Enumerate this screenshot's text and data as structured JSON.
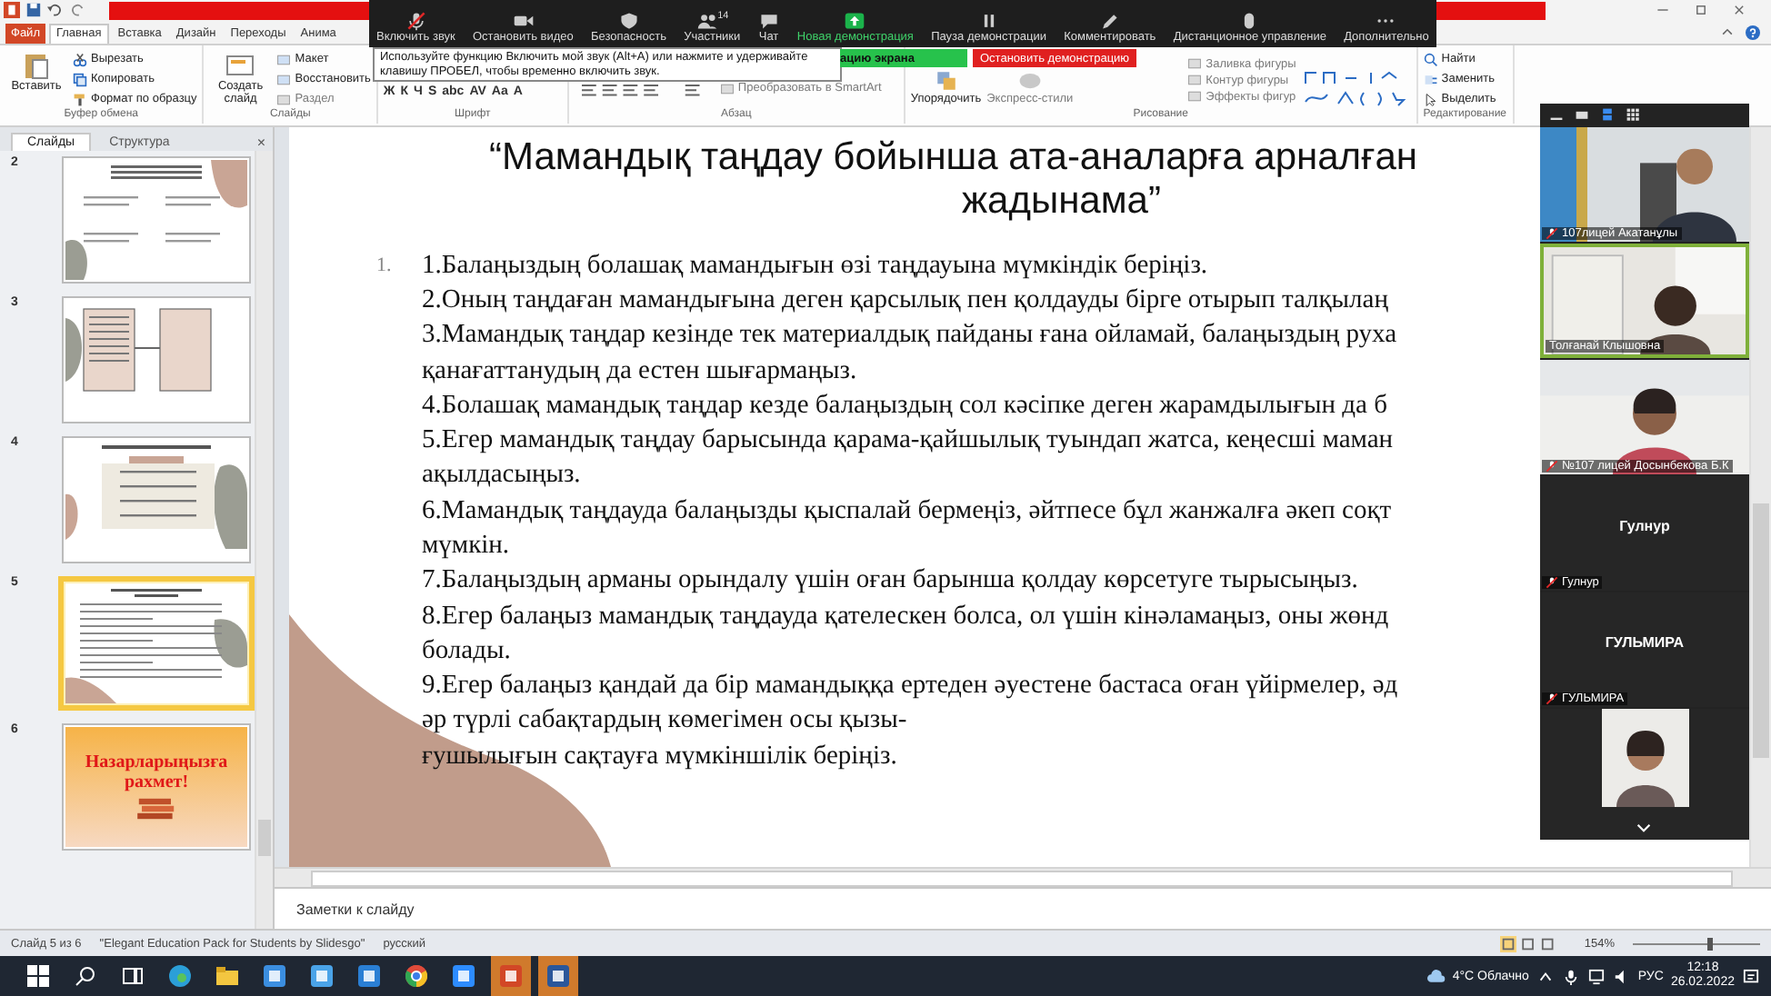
{
  "ribbon": {
    "tabs": [
      {
        "label": "Файл",
        "selected": false,
        "kind": "file"
      },
      {
        "label": "Главная",
        "selected": true,
        "kind": "tab"
      },
      {
        "label": "Вставка",
        "selected": false,
        "kind": "tab"
      },
      {
        "label": "Дизайн",
        "selected": false,
        "kind": "tab"
      },
      {
        "label": "Переходы",
        "selected": false,
        "kind": "tab"
      },
      {
        "label": "Анима",
        "selected": false,
        "kind": "tab"
      }
    ],
    "groups": [
      {
        "label": "Буфер обмена",
        "large": [
          {
            "label": "Вставить",
            "kind": "paste",
            "disabled": false
          }
        ],
        "small": [
          {
            "label": "Вырезать",
            "kind": "cut",
            "disabled": false
          },
          {
            "label": "Копировать",
            "kind": "copy",
            "disabled": false
          },
          {
            "label": "Формат по образцу",
            "kind": "brush",
            "disabled": false
          }
        ]
      },
      {
        "label": "Слайды",
        "large": [
          {
            "label": "Создать слайд",
            "kind": "slide",
            "disabled": false
          }
        ],
        "small": [
          {
            "label": "Макет",
            "kind": "layout",
            "disabled": false
          },
          {
            "label": "Восстановить",
            "kind": "reset",
            "disabled": false
          },
          {
            "label": "Раздел",
            "kind": "section",
            "disabled": true
          }
        ]
      },
      {
        "label": "Шрифт",
        "glyphs": [
          "Ж",
          "К",
          "Ч",
          "S",
          "abc",
          "AV",
          "Aa",
          "A"
        ]
      },
      {
        "label": "Абзац",
        "small": [
          {
            "label": "Преобразовать в SmartArt",
            "kind": "smartart",
            "disabled": true
          }
        ]
      },
      {
        "label": "Рисование",
        "large": [
          {
            "label": "Упорядочить",
            "kind": "arrange",
            "disabled": false
          },
          {
            "label": "Экспресс-стили",
            "kind": "styles",
            "disabled": true
          }
        ],
        "small": [
          {
            "label": "Заливка фигуры",
            "kind": "fill",
            "disabled": true
          },
          {
            "label": "Контур фигуры",
            "kind": "outline",
            "disabled": true
          },
          {
            "label": "Эффекты фигур",
            "kind": "effects",
            "disabled": true
          }
        ]
      },
      {
        "label": "Редактирование",
        "small": [
          {
            "label": "Найти",
            "kind": "find",
            "disabled": false
          },
          {
            "label": "Заменить",
            "kind": "replace",
            "disabled": false
          },
          {
            "label": "Выделить",
            "kind": "select",
            "disabled": false
          }
        ]
      }
    ]
  },
  "meeting": {
    "buttons": [
      {
        "label": "Включить звук",
        "kind": "mic"
      },
      {
        "label": "Остановить видео",
        "kind": "video"
      },
      {
        "label": "Безопасность",
        "kind": "shield"
      },
      {
        "label": "Участники",
        "kind": "people",
        "count": "14"
      },
      {
        "label": "Чат",
        "kind": "chat"
      },
      {
        "label": "Новая демонстрация",
        "kind": "share"
      },
      {
        "label": "Пауза демонстрации",
        "kind": "pause"
      },
      {
        "label": "Комментировать",
        "kind": "pen"
      },
      {
        "label": "Дистанционное управление",
        "kind": "mouse"
      },
      {
        "label": "Дополнительно",
        "kind": "more"
      }
    ],
    "tooltip": "Используйте функцию Включить мой звук (Alt+A) или нажмите и удерживайте клавишу ПРОБЕЛ, чтобы временно включить звук.",
    "sharing_label": "ацию экрана",
    "stop_button": "Остановить демонстрацию",
    "tiles": [
      {
        "kind": "video",
        "name": "107лицей Акатанұлы",
        "muted": true,
        "speaking": false
      },
      {
        "kind": "video",
        "name": "Толғанай Клышовна",
        "muted": false,
        "speaking": true
      },
      {
        "kind": "video",
        "name": "№107 лицей Досынбекова Б.К",
        "muted": true,
        "speaking": false
      },
      {
        "kind": "avatar",
        "display": "Гулнур",
        "name": "Гулнур",
        "muted": true,
        "speaking": false
      },
      {
        "kind": "avatar",
        "display": "ГУЛЬМИРА",
        "name": "ГУЛЬМИРА",
        "muted": true,
        "speaking": false
      },
      {
        "kind": "small_video",
        "speaking": false
      }
    ]
  },
  "slides_panel": {
    "tabs": [
      {
        "label": "Слайды",
        "selected": true
      },
      {
        "label": "Структура",
        "selected": false
      }
    ],
    "close": "×",
    "slides": [
      {
        "number": "2",
        "selected": false,
        "kind": "grid"
      },
      {
        "number": "3",
        "selected": false,
        "kind": "boxes"
      },
      {
        "number": "4",
        "selected": false,
        "kind": "list"
      },
      {
        "number": "5",
        "selected": true,
        "kind": "content"
      },
      {
        "number": "6",
        "selected": false,
        "kind": "thanks",
        "title": "Назарларыңызға рахмет!"
      }
    ]
  },
  "slide": {
    "title": [
      "“Мамандық таңдау бойынша ата-аналарға арналған",
      "жадынама”"
    ],
    "marker": "1.",
    "lines": [
      "1.Балаңыздың болашақ мамандығын өзі таңдауына мүмкіндік беріңіз.",
      "2.Оның таңдаған мамандығына деген қарсылық пен қолдауды бірге отырып талқылаң",
      "3.Мамандық таңдар кезінде тек материалдық пайданы ғана ойламай, балаңыздың руха",
      "қанағаттанудың да естен шығармаңыз.",
      "4.Болашақ мамандық таңдар кезде балаңыздың сол кәсіпке деген жарамдылығын да б",
      "5.Егер мамандық таңдау барысында қарама-қайшылық туындап жатса, кеңесші маман",
      "ақылдасыңыз.",
      "6.Мамандық таңдауда балаңызды қыспалай бермеңіз, әйтпесе бұл жанжалға әкеп соқт",
      "мүмкін.",
      "7.Балаңыздың арманы орындалу үшін оған барынша қолдау көрсетуге тырысыңыз.",
      "8.Егер балаңыз мамандық таңдауда қателескен болса, ол үшін кінәламаңыз, оны жөнд",
      "болады.",
      "9.Егер балаңыз қандай да бір мамандыққа ертеден әуестене бастаса оған үйірмелер, әд",
      "әр түрлі сабақтардың көмегімен осы қызы-",
      "ғушылығын сақтауға мүмкіншілік беріңіз."
    ]
  },
  "notes": {
    "placeholder": "Заметки к слайду"
  },
  "status_bar": {
    "slide": "Слайд 5 из 6",
    "theme": "\"Elegant Education Pack for Students by Slidesgo\"",
    "language": "русский",
    "zoom": "154%",
    "level": 0.6
  },
  "taskbar": {
    "apps": [
      {
        "kind": "start"
      },
      {
        "kind": "search"
      },
      {
        "kind": "taskview"
      },
      {
        "kind": "edge"
      },
      {
        "kind": "folder"
      },
      {
        "kind": "store"
      },
      {
        "kind": "mail"
      },
      {
        "kind": "l_app"
      },
      {
        "kind": "chrome"
      },
      {
        "kind": "zoom"
      },
      {
        "kind": "powerpoint"
      },
      {
        "kind": "word"
      }
    ],
    "weather": "4°C Облачно",
    "language": "РУС",
    "time": "12:18",
    "date": "26.02.2022"
  }
}
